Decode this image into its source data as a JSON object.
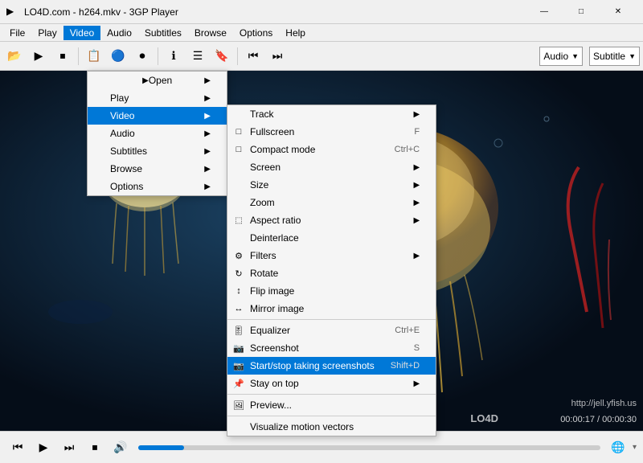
{
  "window": {
    "title": "LO4D.com - h264.mkv - 3GP Player",
    "icon": "▶"
  },
  "titlebar": {
    "minimize": "—",
    "maximize": "□",
    "close": "✕"
  },
  "menubar": {
    "items": [
      "File",
      "Play",
      "Video",
      "Audio",
      "Subtitles",
      "Browse",
      "Options",
      "Help"
    ]
  },
  "toolbar": {
    "buttons": [
      "📂",
      "▶",
      "⏹",
      "⏮",
      "⏭",
      "⏺",
      "📋",
      "ℹ",
      "☰",
      "🔖",
      "⏪",
      "⏩"
    ],
    "audio_label": "Audio",
    "subtitle_label": "Subtitle"
  },
  "context_menu_l1": {
    "items": [
      {
        "label": "Open",
        "has_arrow": true,
        "icon": ""
      },
      {
        "label": "Play",
        "has_arrow": true,
        "icon": ""
      },
      {
        "label": "Video",
        "has_arrow": true,
        "icon": "",
        "active": true
      },
      {
        "label": "Audio",
        "has_arrow": true,
        "icon": ""
      },
      {
        "label": "Subtitles",
        "has_arrow": true,
        "icon": ""
      },
      {
        "label": "Browse",
        "has_arrow": true,
        "icon": ""
      },
      {
        "label": "Options",
        "has_arrow": true,
        "icon": ""
      }
    ]
  },
  "context_menu_l2": {
    "items": [
      {
        "label": "Track",
        "has_arrow": true,
        "shortcut": "",
        "icon": ""
      },
      {
        "label": "Fullscreen",
        "has_arrow": false,
        "shortcut": "F",
        "icon": "□"
      },
      {
        "label": "Compact mode",
        "has_arrow": false,
        "shortcut": "Ctrl+C",
        "icon": "□"
      },
      {
        "label": "Screen",
        "has_arrow": true,
        "shortcut": "",
        "icon": ""
      },
      {
        "label": "Size",
        "has_arrow": true,
        "shortcut": "",
        "icon": ""
      },
      {
        "label": "Zoom",
        "has_arrow": true,
        "shortcut": "",
        "icon": ""
      },
      {
        "label": "Aspect ratio",
        "has_arrow": true,
        "shortcut": "",
        "icon": "□"
      },
      {
        "label": "Deinterlace",
        "has_arrow": false,
        "shortcut": "",
        "icon": ""
      },
      {
        "label": "Filters",
        "has_arrow": true,
        "shortcut": "",
        "icon": "🔧"
      },
      {
        "label": "Rotate",
        "has_arrow": false,
        "shortcut": "",
        "icon": "🔄"
      },
      {
        "label": "Flip image",
        "has_arrow": false,
        "shortcut": "",
        "icon": "↔"
      },
      {
        "label": "Mirror image",
        "has_arrow": false,
        "shortcut": "",
        "icon": "🔲"
      },
      {
        "label": "Equalizer",
        "has_arrow": false,
        "shortcut": "Ctrl+E",
        "icon": "🎚"
      },
      {
        "label": "Screenshot",
        "has_arrow": false,
        "shortcut": "S",
        "icon": "📷"
      },
      {
        "label": "Start/stop taking screenshots",
        "has_arrow": false,
        "shortcut": "Shift+D",
        "icon": "📷",
        "highlighted": true
      },
      {
        "label": "Stay on top",
        "has_arrow": true,
        "shortcut": "",
        "icon": "📌"
      },
      {
        "label": "Preview...",
        "has_arrow": false,
        "shortcut": "",
        "icon": "🖼"
      },
      {
        "label": "Visualize motion vectors",
        "has_arrow": false,
        "shortcut": "",
        "icon": ""
      }
    ]
  },
  "video": {
    "watermark": "http://jell.yfish.us",
    "timer": "00:00:17 / 00:00:30"
  },
  "bottombar": {
    "play": "⏮",
    "prev": "⏮",
    "next": "⏭",
    "vol": "🔊",
    "url": "🌐"
  }
}
